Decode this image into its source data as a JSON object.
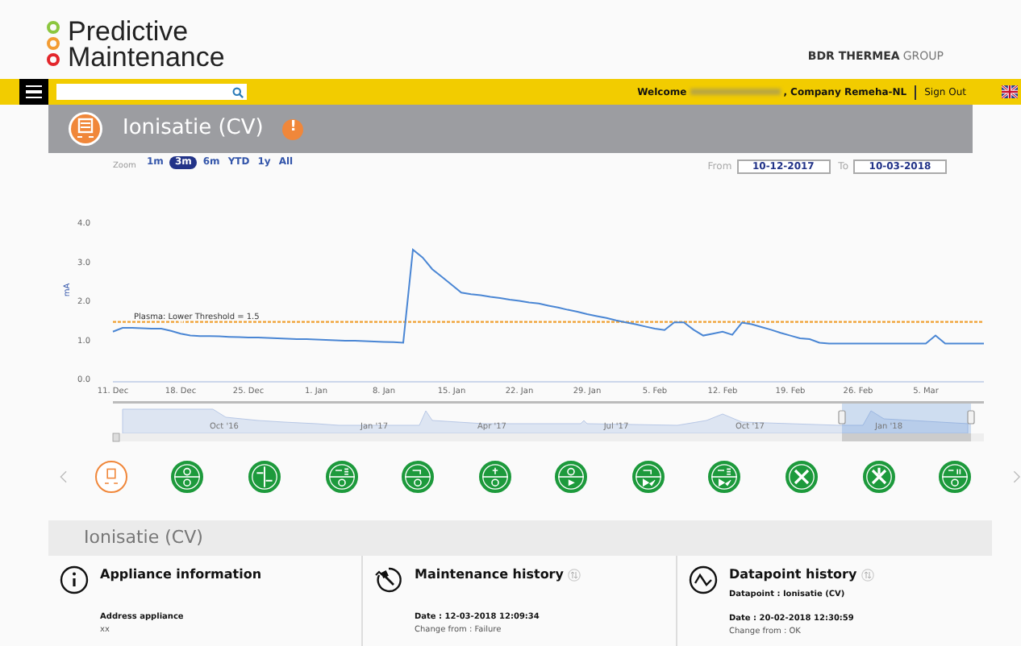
{
  "header": {
    "logo_line_1": "Predictive",
    "logo_line_2": "Maintenance",
    "brand_bold": "BDR THERMEA",
    "brand_light": "GROUP"
  },
  "top_bar": {
    "welcome": "Welcome",
    "company": ", Company Remeha-NL",
    "sign_out": "Sign Out"
  },
  "banner": {
    "title": "Ionisatie (CV)",
    "alert": "!"
  },
  "zoom": {
    "label": "Zoom",
    "buttons": [
      {
        "label": "1m",
        "selected": false
      },
      {
        "label": "3m",
        "selected": true
      },
      {
        "label": "6m",
        "selected": false
      },
      {
        "label": "YTD",
        "selected": false
      },
      {
        "label": "1y",
        "selected": false
      },
      {
        "label": "All",
        "selected": false
      }
    ]
  },
  "range": {
    "from_label": "From",
    "from": "10-12-2017",
    "to_label": "To",
    "to": "10-03-2018"
  },
  "chart_data": {
    "type": "line",
    "ylabel": "mA",
    "ylim": [
      0,
      4
    ],
    "yticks": [
      {
        "value": 0,
        "label": "0.0"
      },
      {
        "value": 1,
        "label": "1.0"
      },
      {
        "value": 2,
        "label": "2.0"
      },
      {
        "value": 3,
        "label": "3.0"
      },
      {
        "value": 4,
        "label": "4.0"
      }
    ],
    "categories": [
      "11. Dec",
      null,
      null,
      null,
      null,
      null,
      null,
      "18. Dec",
      null,
      null,
      null,
      null,
      null,
      null,
      "25. Dec",
      null,
      null,
      null,
      null,
      null,
      null,
      "1. Jan",
      null,
      null,
      null,
      null,
      null,
      null,
      "8. Jan",
      null,
      null,
      null,
      null,
      null,
      null,
      "15. Jan",
      null,
      null,
      null,
      null,
      null,
      null,
      "22. Jan",
      null,
      null,
      null,
      null,
      null,
      null,
      "29. Jan",
      null,
      null,
      null,
      null,
      null,
      null,
      "5. Feb",
      null,
      null,
      null,
      null,
      null,
      null,
      "12. Feb",
      null,
      null,
      null,
      null,
      null,
      null,
      "19. Feb",
      null,
      null,
      null,
      null,
      null,
      null,
      "26. Feb",
      null,
      null,
      null,
      null,
      null,
      null,
      "5. Mar",
      null,
      null,
      null,
      null,
      null,
      null
    ],
    "series": [
      {
        "color": "#4a86d4",
        "values": [
          1.2,
          1.3,
          1.3,
          1.29,
          1.28,
          1.28,
          1.22,
          1.15,
          1.1,
          1.09,
          1.09,
          1.08,
          1.07,
          1.06,
          1.05,
          1.05,
          1.04,
          1.03,
          1.02,
          1.01,
          1.01,
          1.0,
          0.99,
          0.98,
          0.97,
          0.97,
          0.96,
          0.95,
          0.94,
          0.93,
          0.92,
          3.3,
          3.1,
          2.8,
          2.6,
          2.4,
          2.2,
          2.16,
          2.13,
          2.09,
          2.06,
          2.02,
          1.99,
          1.95,
          1.92,
          1.87,
          1.82,
          1.76,
          1.71,
          1.65,
          1.6,
          1.55,
          1.49,
          1.44,
          1.39,
          1.33,
          1.28,
          1.24,
          1.44,
          1.44,
          1.25,
          1.1,
          1.15,
          1.2,
          1.12,
          1.43,
          1.39,
          1.32,
          1.25,
          1.17,
          1.1,
          1.03,
          1.01,
          0.92,
          0.9,
          0.9,
          0.9,
          0.9,
          0.9,
          0.9,
          0.9,
          0.9,
          0.9,
          0.9,
          0.9,
          1.1,
          0.9,
          0.9,
          0.9,
          0.9,
          0.9
        ]
      },
      {
        "name": "Plasma: Lower Threshold = 1.5",
        "color": "#f0a030",
        "line_style": "dashed",
        "values": [
          1.45,
          1.45,
          1.45,
          1.45,
          1.45,
          1.45,
          1.45,
          1.45,
          1.45,
          1.45,
          1.45,
          1.45,
          1.45,
          1.45,
          1.45,
          1.45,
          1.45,
          1.45,
          1.45,
          1.45,
          1.45,
          1.45,
          1.45,
          1.45,
          1.45,
          1.45,
          1.45,
          1.45,
          1.45,
          1.45,
          1.45,
          1.45,
          1.45,
          1.45,
          1.45,
          1.45,
          1.45,
          1.45,
          1.45,
          1.45,
          1.45,
          1.45,
          1.45,
          1.45,
          1.45,
          1.45,
          1.45,
          1.45,
          1.45,
          1.45,
          1.45,
          1.45,
          1.45,
          1.45,
          1.45,
          1.45,
          1.45,
          1.45,
          1.45,
          1.45,
          1.45,
          1.45,
          1.45,
          1.45,
          1.45,
          1.45,
          1.45,
          1.45,
          1.45,
          1.45,
          1.45,
          1.45,
          1.45,
          1.45,
          1.45,
          1.45,
          1.45,
          1.45,
          1.45,
          1.45,
          1.45,
          1.45,
          1.45,
          1.45,
          1.45,
          1.45,
          1.45,
          1.45,
          1.45,
          1.45,
          1.45
        ]
      }
    ]
  },
  "navigator": {
    "labels": [
      "Oct '16",
      "Jan '17",
      "Apr '17",
      "Jul '17",
      "Oct '17",
      "Jan '18"
    ]
  },
  "datapoints": [
    {
      "selected": true
    },
    {
      "selected": false
    },
    {
      "selected": false
    },
    {
      "selected": false
    },
    {
      "selected": false
    },
    {
      "selected": false
    },
    {
      "selected": false
    },
    {
      "selected": false
    },
    {
      "selected": false
    },
    {
      "selected": false
    },
    {
      "selected": false
    },
    {
      "selected": false
    }
  ],
  "section": {
    "title": "Ionisatie (CV)"
  },
  "panels": [
    {
      "kind": "info",
      "title": "Appliance information",
      "lines": [
        {
          "text": "Address appliance",
          "bold": true
        },
        {
          "text": "xx",
          "bold": false
        }
      ]
    },
    {
      "kind": "maintenance",
      "title": "Maintenance history",
      "sortable": true,
      "lines": [
        {
          "text": "Date : 12-03-2018 12:09:34",
          "bold": true
        },
        {
          "text": "Change from : Failure",
          "bold": false
        }
      ]
    },
    {
      "kind": "datapoint",
      "title": "Datapoint history",
      "sortable": true,
      "subtitle": "Datapoint : Ionisatie (CV)",
      "lines": [
        {
          "text": "Date : 20-02-2018 12:30:59",
          "bold": true
        },
        {
          "text": "Change from : OK",
          "bold": false
        }
      ]
    }
  ]
}
